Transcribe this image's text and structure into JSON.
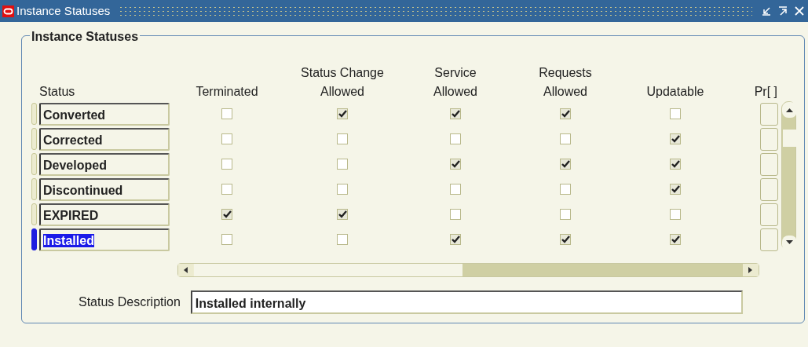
{
  "window": {
    "title": "Instance Statuses"
  },
  "frame": {
    "title": "Instance Statuses"
  },
  "columns": [
    {
      "lines": [
        "Status"
      ]
    },
    {
      "lines": [
        "Terminated"
      ]
    },
    {
      "lines": [
        "Status Change",
        "Allowed"
      ]
    },
    {
      "lines": [
        "Service",
        "Allowed"
      ]
    },
    {
      "lines": [
        "Requests",
        "Allowed"
      ]
    },
    {
      "lines": [
        "Updatable"
      ]
    },
    {
      "lines": [
        "Pr[ ]"
      ]
    }
  ],
  "rows": [
    {
      "status": "Converted",
      "selected": false,
      "checks": [
        false,
        true,
        true,
        true,
        false
      ]
    },
    {
      "status": "Corrected",
      "selected": false,
      "checks": [
        false,
        false,
        false,
        false,
        true
      ]
    },
    {
      "status": "Developed",
      "selected": false,
      "checks": [
        false,
        false,
        true,
        true,
        true
      ]
    },
    {
      "status": "Discontinued",
      "selected": false,
      "checks": [
        false,
        false,
        false,
        false,
        true
      ]
    },
    {
      "status": "EXPIRED",
      "selected": false,
      "checks": [
        true,
        true,
        false,
        false,
        false
      ]
    },
    {
      "status": "Installed",
      "selected": true,
      "checks": [
        false,
        false,
        true,
        true,
        true
      ]
    }
  ],
  "description": {
    "label": "Status Description",
    "value": "Installed internally"
  }
}
